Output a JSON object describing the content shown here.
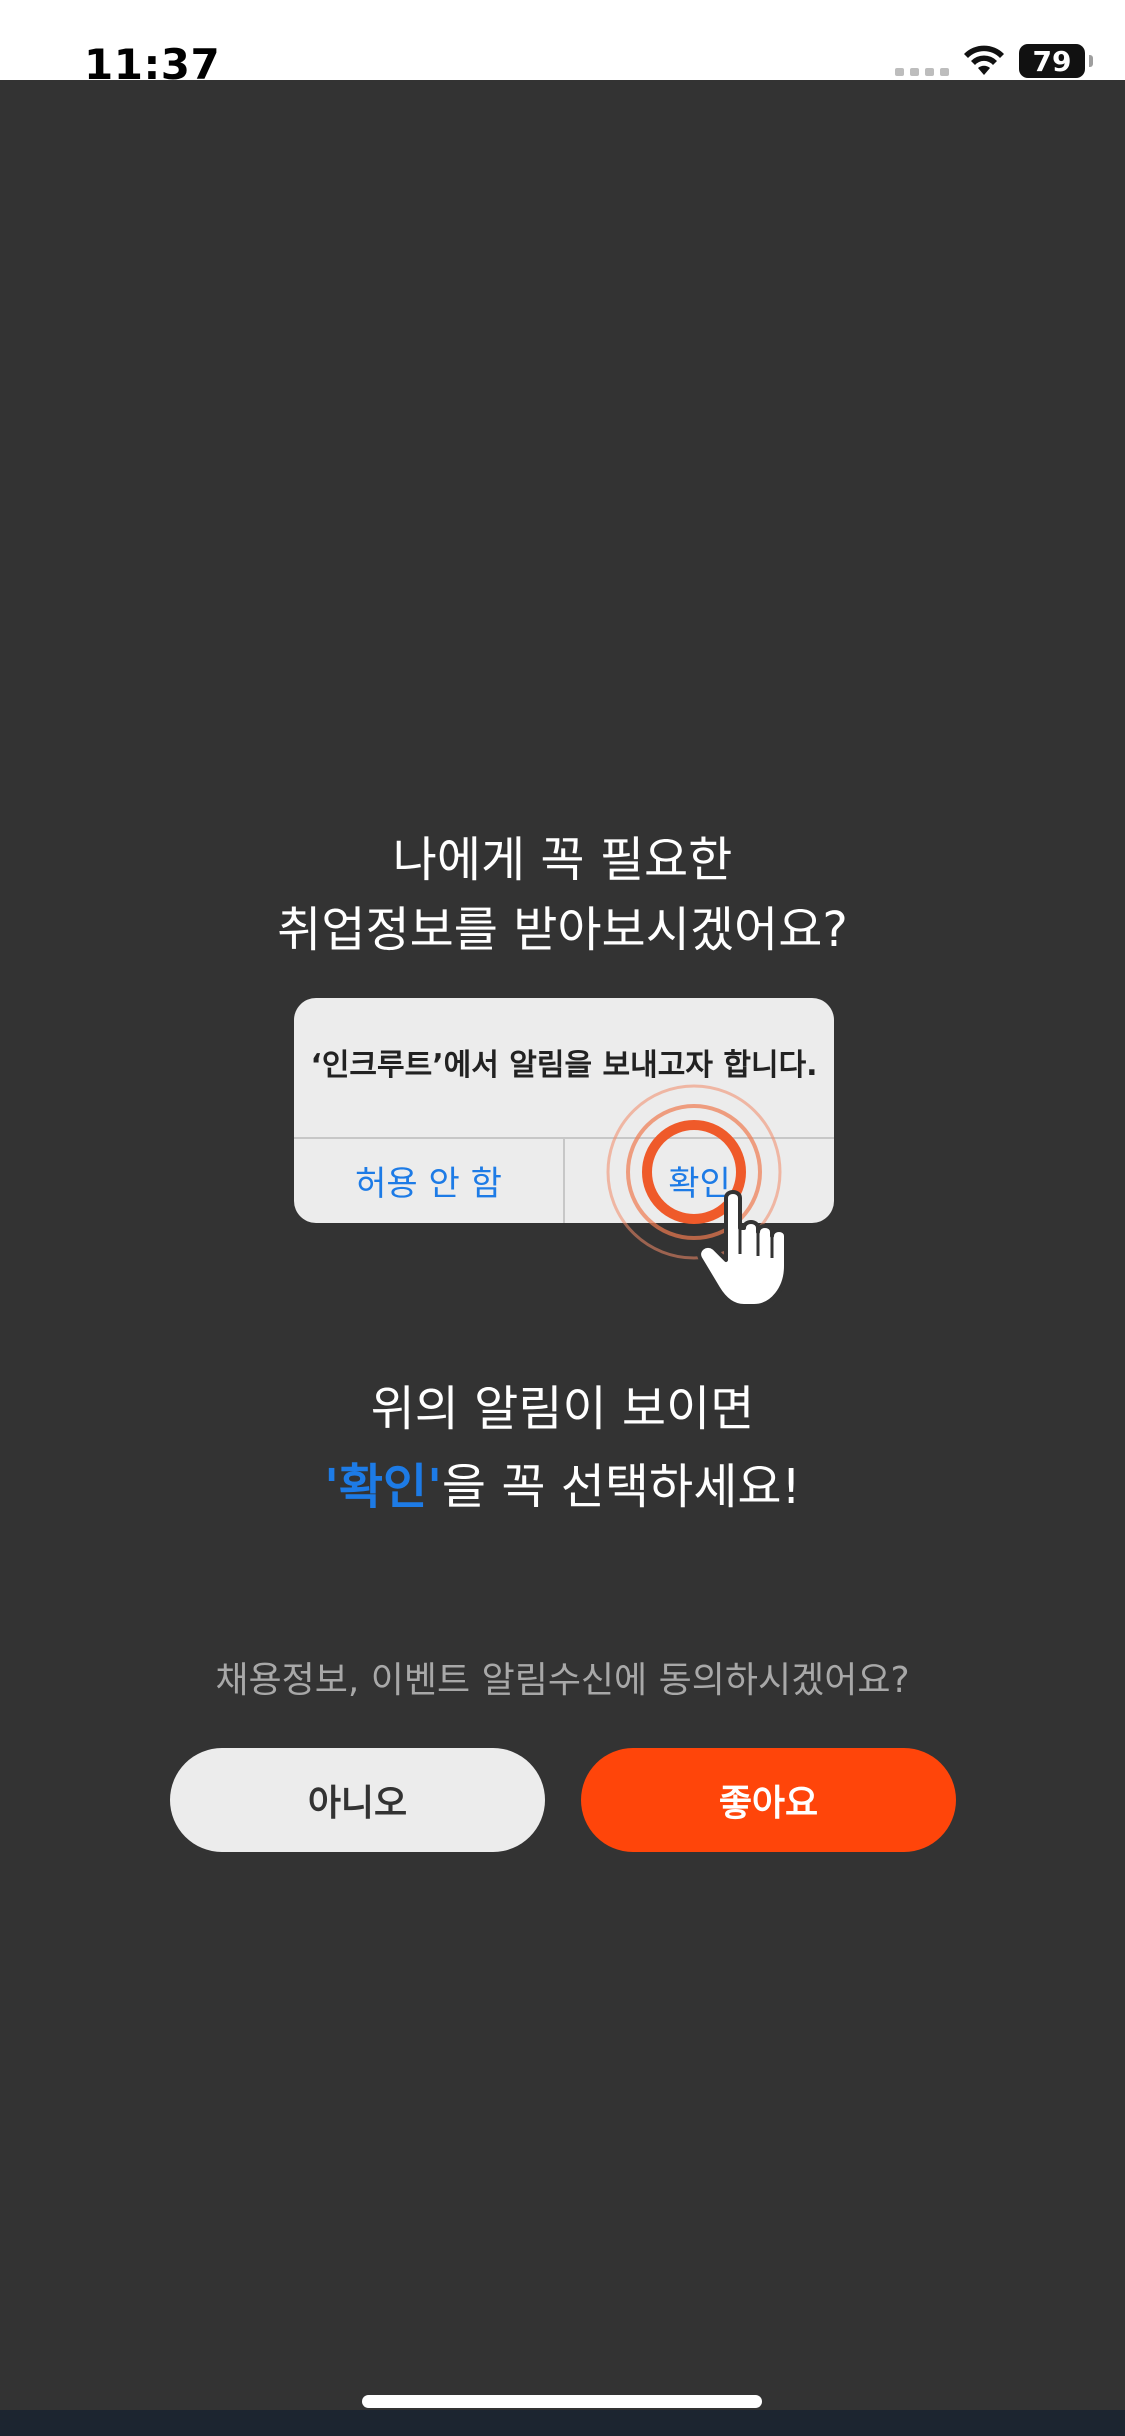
{
  "status_bar": {
    "time": "11:37",
    "battery": "79"
  },
  "headline": {
    "line1": "나에게 꼭 필요한",
    "line2": "취업정보를 받아보시겠어요?"
  },
  "alert_example": {
    "message": "‘인크루트’에서 알림을 보내고자 합니다.",
    "deny_label": "허용 안 함",
    "allow_label": "확인"
  },
  "instruction": {
    "line1": "위의 알림이 보이면",
    "highlight": "'확인'",
    "line2_rest": "을 꼭 선택하세요!"
  },
  "consent": {
    "question": "채용정보, 이벤트 알림수신에 동의하시겠어요?",
    "no_label": "아니오",
    "yes_label": "좋아요"
  },
  "colors": {
    "overlay": "#333333",
    "accent_orange": "#ff450a",
    "ios_blue": "#1d7be6"
  }
}
